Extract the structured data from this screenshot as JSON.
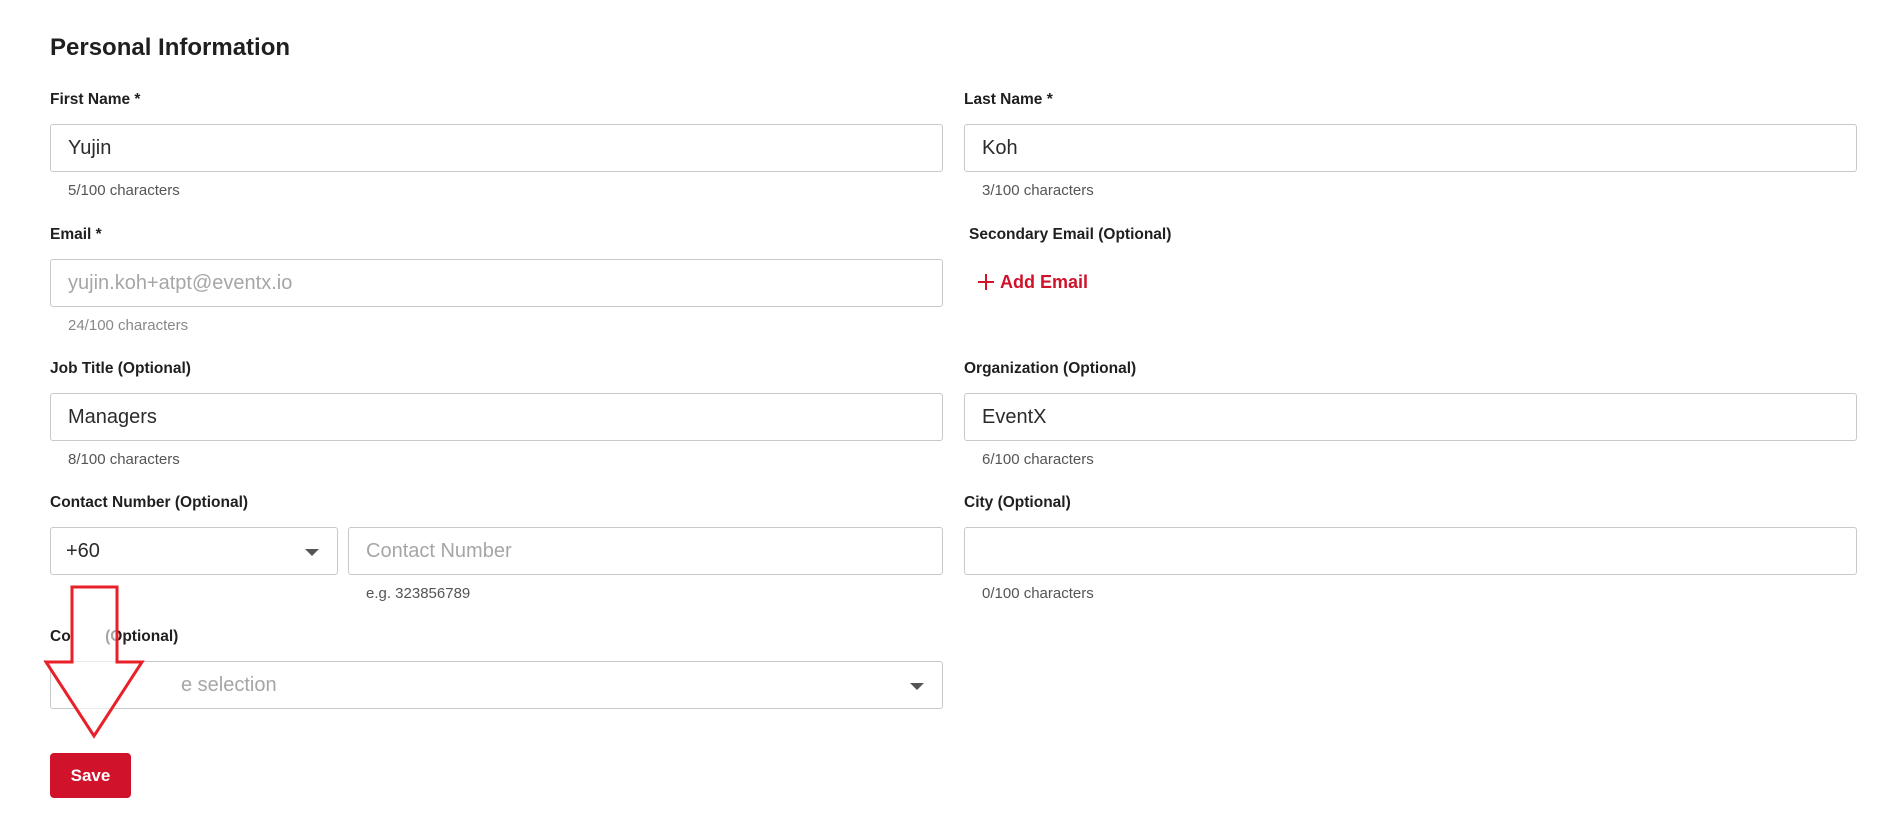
{
  "section": {
    "title": "Personal Information"
  },
  "fields": {
    "first_name": {
      "label": "First Name *",
      "value": "Yujin",
      "counter": "5/100 characters"
    },
    "last_name": {
      "label": "Last Name *",
      "value": "Koh",
      "counter": "3/100 characters"
    },
    "email": {
      "label": "Email *",
      "placeholder": "yujin.koh+atpt@eventx.io",
      "counter": "24/100 characters"
    },
    "secondary_email": {
      "label": "Secondary Email (Optional)",
      "add_label": "Add Email"
    },
    "job_title": {
      "label": "Job Title (Optional)",
      "value": "Managers",
      "counter": "8/100 characters"
    },
    "organization": {
      "label": "Organization (Optional)",
      "value": "EventX",
      "counter": "6/100 characters"
    },
    "contact_number": {
      "label": "Contact Number (Optional)",
      "country_code": "+60",
      "placeholder": "Contact Number",
      "hint": "e.g. 323856789"
    },
    "city": {
      "label": "City (Optional)",
      "value": "",
      "counter": "0/100 characters"
    },
    "country": {
      "label": "Co        (Optional)",
      "placeholder": "e selection"
    }
  },
  "actions": {
    "save_label": "Save"
  },
  "colors": {
    "accent": "#d0122b",
    "annotation_arrow": "#e8202a"
  }
}
